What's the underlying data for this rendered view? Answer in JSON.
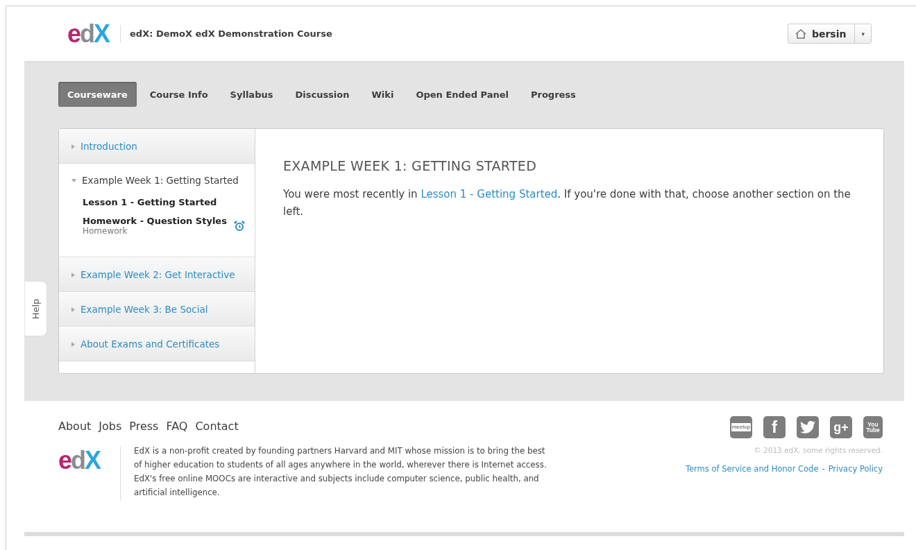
{
  "header": {
    "logo": "edX",
    "course_title": "edX: DemoX edX Demonstration Course",
    "user": {
      "name": "bersin",
      "menu": "▾"
    }
  },
  "tabs": [
    {
      "label": "Courseware",
      "selected": true
    },
    {
      "label": "Course Info",
      "selected": false
    },
    {
      "label": "Syllabus",
      "selected": false
    },
    {
      "label": "Discussion",
      "selected": false
    },
    {
      "label": "Wiki",
      "selected": false
    },
    {
      "label": "Open Ended Panel",
      "selected": false
    },
    {
      "label": "Progress",
      "selected": false
    }
  ],
  "sidebar": {
    "chapters": [
      {
        "title": "Introduction",
        "expanded": false
      },
      {
        "title": "Example Week 1: Getting Started",
        "expanded": true,
        "children": [
          {
            "title": "Lesson 1 - Getting Started"
          },
          {
            "title": "Homework - Question Styles",
            "subtitle": "Homework",
            "due_alarm": true
          }
        ]
      },
      {
        "title": "Example Week 2: Get Interactive",
        "expanded": false
      },
      {
        "title": "Example Week 3: Be Social",
        "expanded": false
      },
      {
        "title": "About Exams and Certificates",
        "expanded": false
      }
    ]
  },
  "content": {
    "heading": "EXAMPLE WEEK 1: GETTING STARTED",
    "text_before": "You were most recently in ",
    "link": "Lesson 1 - Getting Started",
    "text_after": ". If you're done with that, choose another section on the left."
  },
  "help_tab": "Help",
  "footer": {
    "links": [
      "About",
      "Jobs",
      "Press",
      "FAQ",
      "Contact"
    ],
    "logo": "edX",
    "about": "EdX is a non-profit created by founding partners Harvard and MIT whose mission is to bring the best of higher education to students of all ages anywhere in the world, wherever there is Internet access. EdX's free online MOOCs are interactive and subjects include computer science, public health, and artificial intelligence.",
    "social": [
      {
        "kind": "meetup",
        "label": "meetup"
      },
      {
        "kind": "facebook",
        "label": "f"
      },
      {
        "kind": "twitter"
      },
      {
        "kind": "googleplus",
        "label": "g+"
      },
      {
        "kind": "youtube",
        "label": "You Tube"
      }
    ],
    "copyright": "© 2013 edX, some rights reserved.",
    "legal_links": [
      "Terms of Service and Honor Code",
      "Privacy Policy"
    ],
    "legal_separator": "-"
  }
}
